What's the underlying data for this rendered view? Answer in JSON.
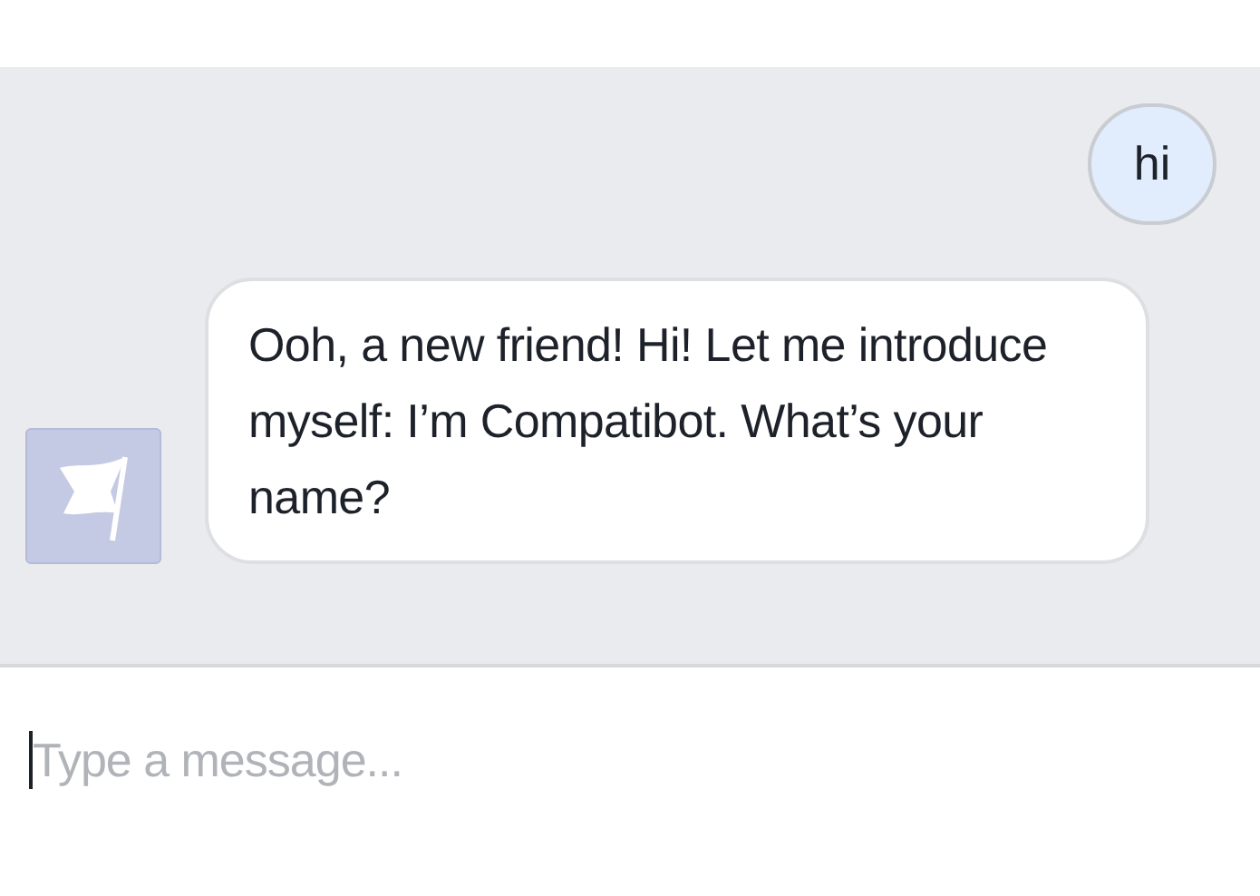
{
  "messages": [
    {
      "kind": "user",
      "text": "hi"
    },
    {
      "kind": "bot",
      "text": "Ooh, a new friend! Hi! Let me introduce myself: I’m Compatibot. What’s your name?"
    }
  ],
  "composer": {
    "placeholder": "Type a message..."
  }
}
